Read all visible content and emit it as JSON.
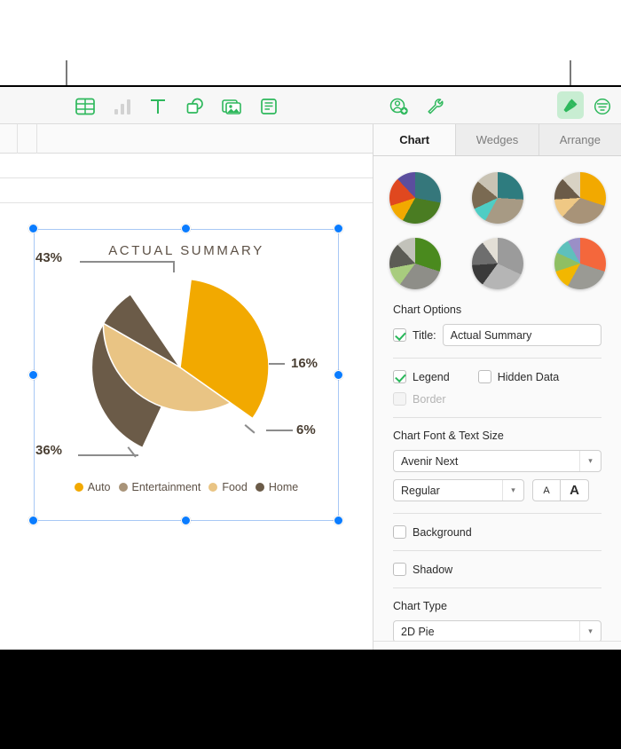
{
  "toolbar": {
    "left_items": [
      {
        "name": "table-icon",
        "label": "Table",
        "enabled": true
      },
      {
        "name": "chart-icon",
        "label": "Chart",
        "enabled": false
      },
      {
        "name": "text-icon",
        "label": "Text",
        "enabled": true
      },
      {
        "name": "shape-icon",
        "label": "Shape",
        "enabled": true
      },
      {
        "name": "media-icon",
        "label": "Media",
        "enabled": true
      },
      {
        "name": "comment-icon",
        "label": "Comment",
        "enabled": true
      }
    ],
    "right_items": [
      {
        "name": "collaborate-icon",
        "label": "Collaborate"
      },
      {
        "name": "wrench-icon",
        "label": "Tools"
      },
      {
        "name": "format-icon",
        "label": "Format",
        "active": true
      },
      {
        "name": "organize-icon",
        "label": "Organize"
      }
    ],
    "accent_color": "#2eb85c",
    "active_bg": "#c8edd2"
  },
  "chart_data": {
    "type": "pie",
    "title": "ACTUAL SUMMARY",
    "categories": [
      "Auto",
      "Entertainment",
      "Food",
      "Home"
    ],
    "values": [
      16,
      6,
      36,
      43
    ],
    "value_labels": [
      "16%",
      "6%",
      "36%",
      "43%"
    ],
    "colors": [
      "#F2A900",
      "#A89378",
      "#E9C484",
      "#6B5B48"
    ],
    "legend": "bottom",
    "legend_entries": [
      {
        "label": "Auto",
        "color": "#F2A900",
        "value": "16%"
      },
      {
        "label": "Entertainment",
        "color": "#A89378",
        "value": "6%"
      },
      {
        "label": "Food",
        "color": "#E9C484",
        "value": "36%"
      },
      {
        "label": "Home",
        "color": "#6B5B48",
        "value": "43%"
      }
    ],
    "labels_outside": true,
    "grid": false
  },
  "panel": {
    "tabs": [
      {
        "label": "Chart",
        "active": true
      },
      {
        "label": "Wedges",
        "active": false
      },
      {
        "label": "Arrange",
        "active": false
      }
    ],
    "styles": [
      {
        "name": "chart-style-1",
        "colors": [
          "#35777B",
          "#4A7C22",
          "#F2A900",
          "#E0481F",
          "#5B4E9E"
        ]
      },
      {
        "name": "chart-style-2",
        "colors": [
          "#2E7C7F",
          "#A79A84",
          "#4ECDC4",
          "#7A6A52",
          "#C9C3B4"
        ]
      },
      {
        "name": "chart-style-3",
        "colors": [
          "#F2A900",
          "#A89378",
          "#EFC884",
          "#6B5B48",
          "#D8D2C4"
        ]
      },
      {
        "name": "chart-style-4",
        "colors": [
          "#4A8A1E",
          "#8E8E88",
          "#A8CC7E",
          "#5C5C55",
          "#C2C2BA"
        ]
      },
      {
        "name": "chart-style-5",
        "colors": [
          "#9B9B9B",
          "#B5B5B5",
          "#3A3A3A",
          "#6E6E6E",
          "#E3DFD6"
        ]
      },
      {
        "name": "chart-style-6",
        "colors": [
          "#F4673C",
          "#9A9A94",
          "#F2B700",
          "#8FBF63",
          "#5EC0BC"
        ]
      }
    ],
    "chart_options": {
      "heading": "Chart Options",
      "title_label": "Title:",
      "title_checked": true,
      "title_value": "Actual Summary",
      "legend_label": "Legend",
      "legend_checked": true,
      "hidden_data_label": "Hidden Data",
      "hidden_data_checked": false,
      "border_label": "Border",
      "border_checked": false,
      "border_disabled": true
    },
    "font_section": {
      "heading": "Chart Font & Text Size",
      "font_family": "Avenir Next",
      "font_weight": "Regular",
      "decrease_size_label": "A",
      "increase_size_label": "A"
    },
    "background_label": "Background",
    "background_checked": false,
    "shadow_label": "Shadow",
    "shadow_checked": false,
    "chart_type": {
      "heading": "Chart Type",
      "value": "2D Pie"
    }
  }
}
